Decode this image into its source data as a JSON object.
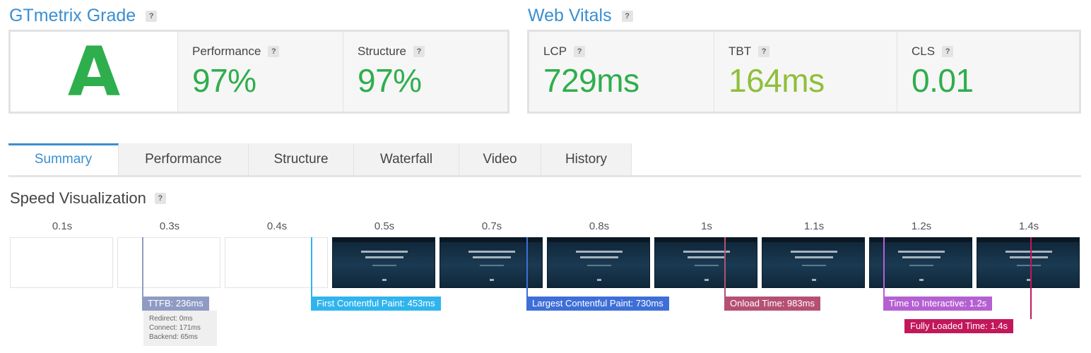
{
  "grade": {
    "title": "GTmetrix Grade",
    "help": "?",
    "letter": "A",
    "performance": {
      "label": "Performance",
      "value": "97%"
    },
    "structure": {
      "label": "Structure",
      "value": "97%"
    }
  },
  "vitals": {
    "title": "Web Vitals",
    "help": "?",
    "lcp": {
      "label": "LCP",
      "value": "729ms"
    },
    "tbt": {
      "label": "TBT",
      "value": "164ms"
    },
    "cls": {
      "label": "CLS",
      "value": "0.01"
    }
  },
  "colors": {
    "accent": "#3a8fd1",
    "grade_green": "#2fae4d",
    "good_green": "#2fae4d",
    "ok_green": "#8fbf3a"
  },
  "tabs": [
    "Summary",
    "Performance",
    "Structure",
    "Waterfall",
    "Video",
    "History"
  ],
  "speed": {
    "title": "Speed Visualization",
    "help": "?",
    "times": [
      "0.1s",
      "0.3s",
      "0.4s",
      "0.5s",
      "0.7s",
      "0.8s",
      "1s",
      "1.1s",
      "1.2s",
      "1.4s"
    ],
    "markers": {
      "ttfb": "TTFB: 236ms",
      "fcp": "First Contentful Paint: 453ms",
      "lcp": "Largest Contentful Paint: 730ms",
      "onload": "Onload Time: 983ms",
      "tti": "Time to Interactive: 1.2s",
      "fully": "Fully Loaded Time: 1.4s"
    },
    "ttfb_detail": {
      "redirect": "Redirect: 0ms",
      "connect": "Connect: 171ms",
      "backend": "Backend: 65ms"
    }
  }
}
